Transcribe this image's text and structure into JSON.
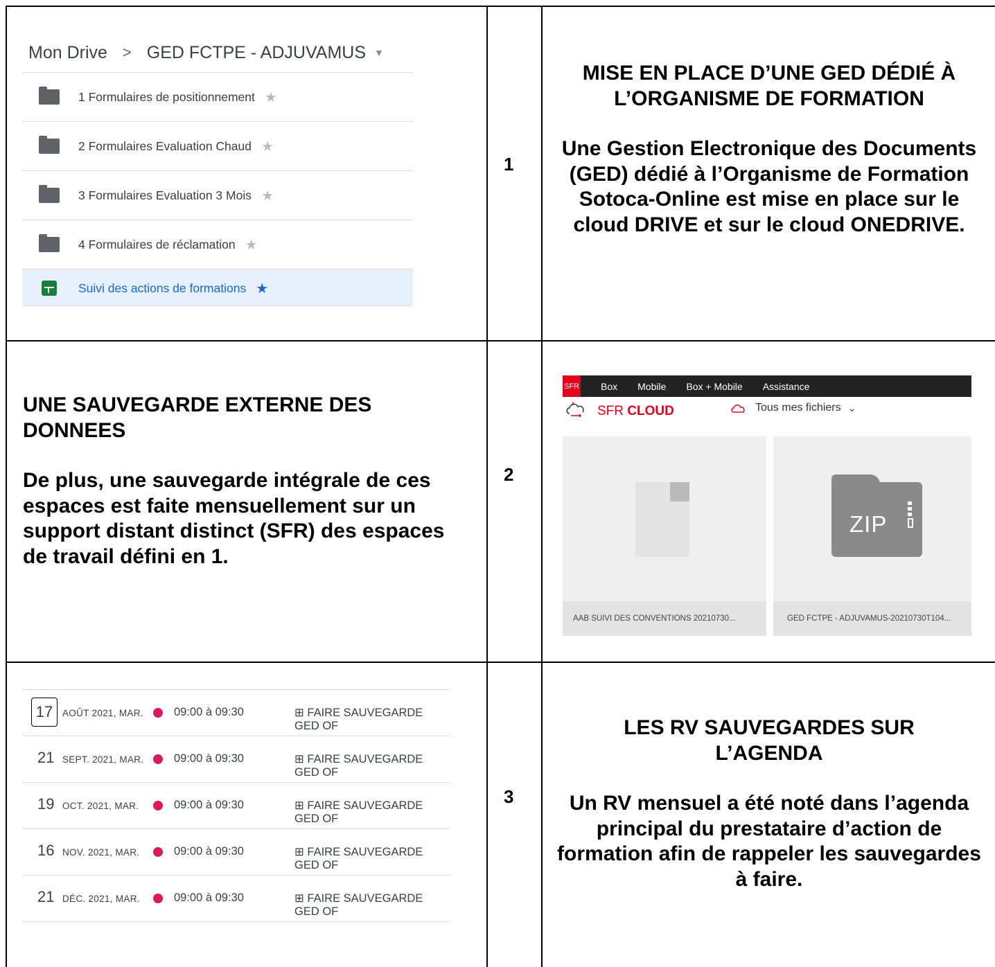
{
  "rows": [
    {
      "number": "1",
      "title": "MISE EN PLACE D’UNE GED DÉDIÉ À L’ORGANISME DE FORMATION",
      "body": "Une Gestion Electronique des Documents (GED) dédié à l’Organisme de Formation Sotoca-Online est mise en place sur le cloud DRIVE et sur le cloud ONEDRIVE."
    },
    {
      "number": "2",
      "title": "UNE SAUVEGARDE EXTERNE DES DONNEES",
      "body": "De plus, une sauvegarde intégrale de ces espaces est faite mensuellement sur un support distant distinct (SFR) des espaces de travail défini en 1."
    },
    {
      "number": "3",
      "title": "LES RV SAUVEGARDES SUR L’AGENDA",
      "body": "Un RV mensuel a été noté dans l’agenda principal du prestataire d’action de formation afin de rappeler les sauvegardes à faire."
    }
  ],
  "drive": {
    "root": "Mon Drive",
    "separator": ">",
    "folder": "GED FCTPE - ADJUVAMUS",
    "items": [
      {
        "label": "1 Formulaires de positionnement",
        "icon": "folder-icon"
      },
      {
        "label": "2 Formulaires Evaluation Chaud",
        "icon": "folder-icon"
      },
      {
        "label": "3 Formulaires Evaluation 3 Mois",
        "icon": "folder-icon"
      },
      {
        "label": "4 Formulaires de réclamation",
        "icon": "folder-icon"
      },
      {
        "label": "Suivi des actions de formations",
        "icon": "spreadsheet-icon",
        "selected": true
      }
    ],
    "star_glyph": "★"
  },
  "sfr": {
    "logo": "SFR",
    "nav": [
      "Box",
      "Mobile",
      "Box + Mobile",
      "Assistance"
    ],
    "brand_prefix": "SFR",
    "brand_bold": "CLOUD",
    "files_menu": "Tous mes fichiers",
    "files": [
      {
        "name": "AAB SUIVI DES CONVENTIONS 20210730...",
        "icon": "document-icon"
      },
      {
        "name": "GED FCTPE - ADJUVAMUS-20210730T104...",
        "icon": "zip-icon",
        "badge": "ZIP"
      }
    ],
    "accent": "#e2001a"
  },
  "calendar": {
    "dot_color": "#d81b60",
    "events": [
      {
        "day": "17",
        "date": "AOÛT 2021, MAR.",
        "time": "09:00 à 09:30",
        "title": "⊞ FAIRE SAUVEGARDE GED OF"
      },
      {
        "day": "21",
        "date": "SEPT. 2021, MAR.",
        "time": "09:00 à 09:30",
        "title": "⊞ FAIRE SAUVEGARDE GED OF"
      },
      {
        "day": "19",
        "date": "OCT. 2021, MAR.",
        "time": "09:00 à 09:30",
        "title": "⊞ FAIRE SAUVEGARDE GED OF"
      },
      {
        "day": "16",
        "date": "NOV. 2021, MAR.",
        "time": "09:00 à 09:30",
        "title": "⊞ FAIRE SAUVEGARDE GED OF"
      },
      {
        "day": "21",
        "date": "DÉC. 2021, MAR.",
        "time": "09:00 à 09:30",
        "title": "⊞ FAIRE SAUVEGARDE GED OF"
      }
    ]
  }
}
